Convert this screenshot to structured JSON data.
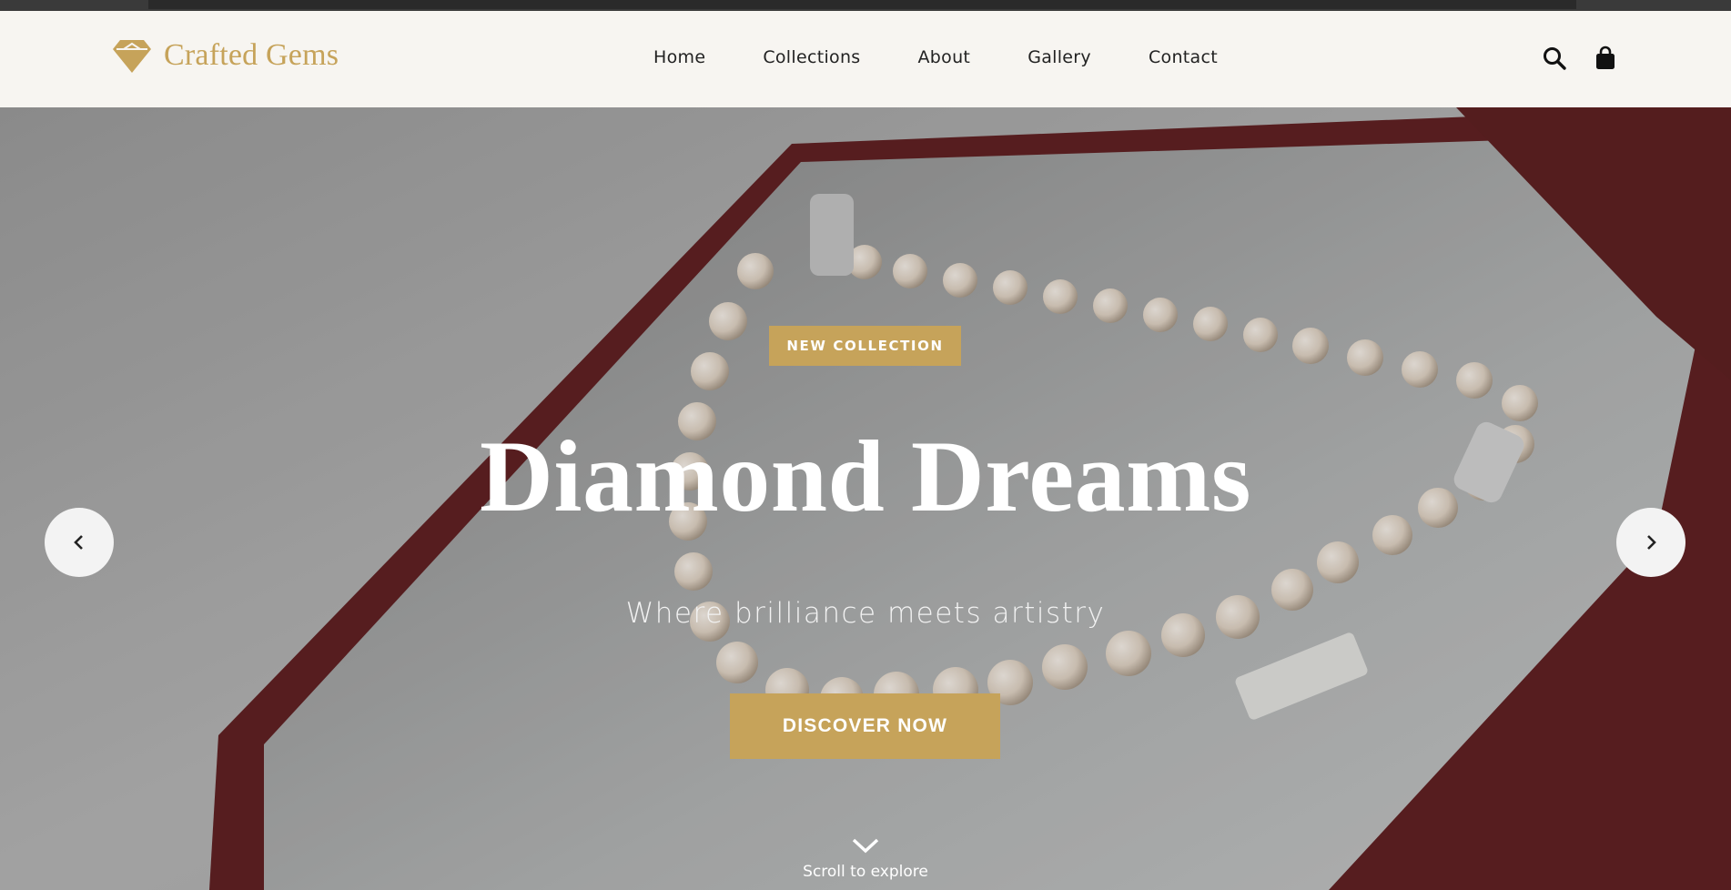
{
  "brand": {
    "name": "Crafted Gems",
    "icon": "diamond-icon",
    "color": "#c6a35a"
  },
  "nav": {
    "items": [
      {
        "label": "Home"
      },
      {
        "label": "Collections"
      },
      {
        "label": "About"
      },
      {
        "label": "Gallery"
      },
      {
        "label": "Contact"
      }
    ]
  },
  "header_icons": {
    "search": "search-icon",
    "cart": "shopping-bag-icon"
  },
  "hero": {
    "badge": "NEW COLLECTION",
    "title": "Diamond Dreams",
    "subtitle": "Where brilliance meets artistry",
    "cta": "DISCOVER NOW",
    "prev_icon": "chevron-left-icon",
    "next_icon": "chevron-right-icon",
    "scroll_text": "Scroll to explore",
    "scroll_icon": "chevron-down-icon"
  },
  "colors": {
    "accent": "#c6a35a",
    "header_bg": "#f7f5f1",
    "box_red": "#6b1a1c"
  }
}
